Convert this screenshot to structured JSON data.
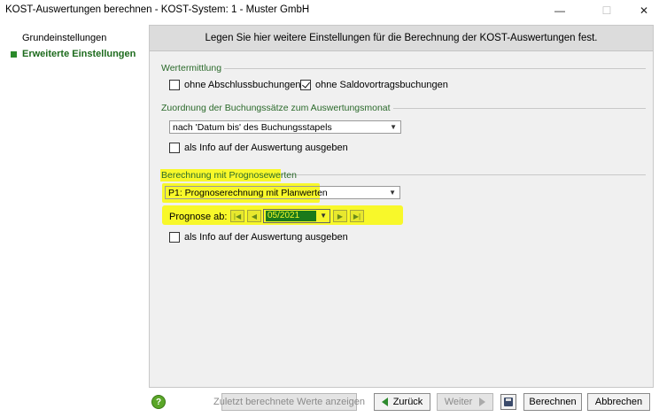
{
  "window": {
    "title": "KOST-Auswertungen berechnen - KOST-System: 1 - Muster GmbH",
    "min_glyph": "—",
    "max_glyph": "☐",
    "close_glyph": "✕"
  },
  "sidebar": {
    "items": [
      {
        "label": "Grundeinstellungen",
        "active": false
      },
      {
        "label": "Erweiterte Einstellungen",
        "active": true
      }
    ]
  },
  "header": {
    "text": "Legen Sie hier weitere Einstellungen für die Berechnung der KOST-Auswertungen fest."
  },
  "wertermittlung": {
    "title": "Wertermittlung",
    "ohne_abschluss": {
      "label": "ohne Abschlussbuchungen",
      "checked": false
    },
    "ohne_saldovortrag": {
      "label": "ohne Saldovortragsbuchungen",
      "checked": true
    }
  },
  "zuordnung": {
    "title": "Zuordnung der Buchungssätze zum Auswertungsmonat",
    "selected": "nach 'Datum bis' des Buchungsstapels",
    "info": {
      "label": "als Info auf der Auswertung ausgeben",
      "checked": false
    }
  },
  "prognose": {
    "title": "Berechnung mit Prognosewerten",
    "selected": "P1: Prognoserechnung mit Planwerten",
    "ab_label": "Prognose ab:",
    "month": "05/2021",
    "info": {
      "label": "als Info auf der Auswertung ausgeben",
      "checked": false
    }
  },
  "footer": {
    "help": "?",
    "zuletzt": "Zuletzt berechnete Werte anzeigen",
    "zurueck": "Zurück",
    "weiter": "Weiter",
    "berechnen": "Berechnen",
    "abbrechen": "Abbrechen"
  },
  "colors": {
    "accent_green": "#2b6a2b",
    "highlight": "#f8f82a"
  }
}
